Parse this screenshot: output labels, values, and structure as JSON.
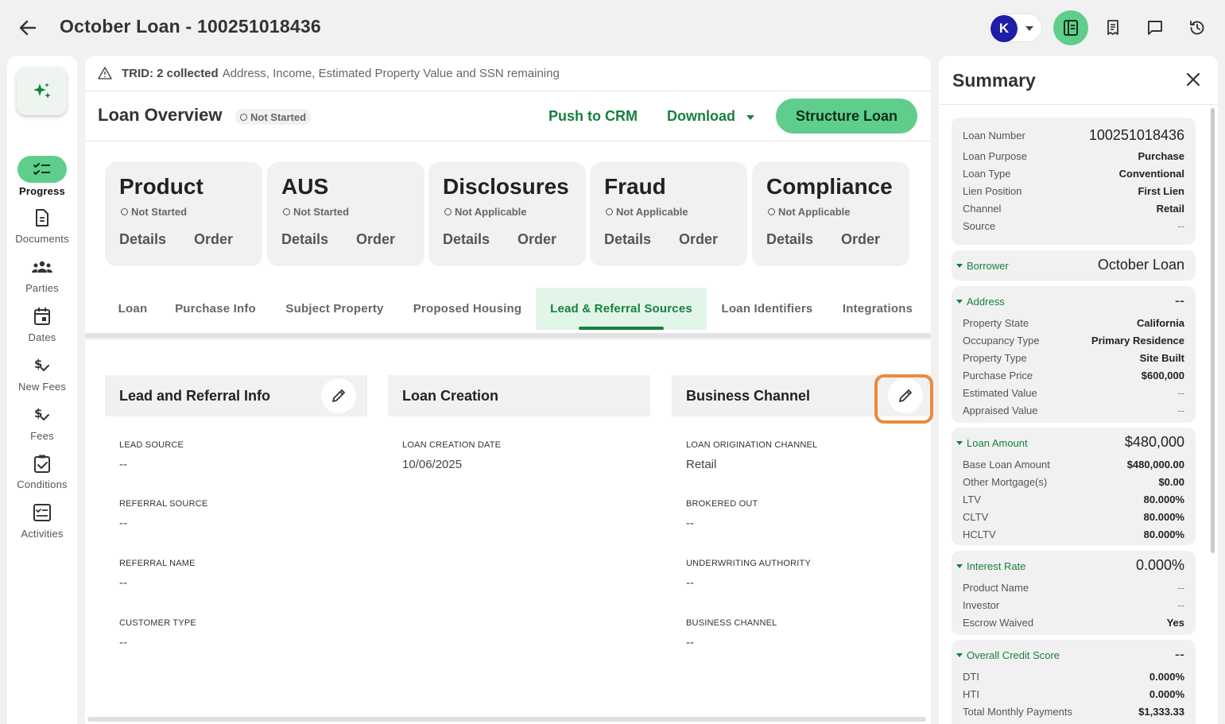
{
  "header": {
    "title": "October Loan - 100251018436",
    "avatar_initial": "K"
  },
  "nav": {
    "items": [
      {
        "label": "Progress"
      },
      {
        "label": "Documents"
      },
      {
        "label": "Parties"
      },
      {
        "label": "Dates"
      },
      {
        "label": "New Fees"
      },
      {
        "label": "Fees"
      },
      {
        "label": "Conditions"
      },
      {
        "label": "Activities"
      }
    ]
  },
  "trid": {
    "prefix": "TRID: 2 collected",
    "remaining": "Address, Income, Estimated Property Value and SSN remaining"
  },
  "overview": {
    "title": "Loan Overview",
    "status": "Not Started",
    "push_label": "Push to CRM",
    "download_label": "Download",
    "structure_label": "Structure Loan"
  },
  "cards": [
    {
      "title": "Product",
      "status": "Not Started",
      "details": "Details",
      "order": "Order"
    },
    {
      "title": "AUS",
      "status": "Not Started",
      "details": "Details",
      "order": "Order"
    },
    {
      "title": "Disclosures",
      "status": "Not Applicable",
      "details": "Details",
      "order": "Order"
    },
    {
      "title": "Fraud",
      "status": "Not Applicable",
      "details": "Details",
      "order": "Order"
    },
    {
      "title": "Compliance",
      "status": "Not Applicable",
      "details": "Details",
      "order": "Order"
    }
  ],
  "tabs": [
    "Loan",
    "Purchase Info",
    "Subject Property",
    "Proposed Housing",
    "Lead & Referral Sources",
    "Loan Identifiers",
    "Integrations"
  ],
  "sections": {
    "lead": {
      "title": "Lead and Referral Info",
      "fields": [
        {
          "label": "LEAD SOURCE",
          "value": "--"
        },
        {
          "label": "REFERRAL SOURCE",
          "value": "--"
        },
        {
          "label": "REFERRAL NAME",
          "value": "--"
        },
        {
          "label": "CUSTOMER TYPE",
          "value": "--"
        }
      ]
    },
    "creation": {
      "title": "Loan Creation",
      "fields": [
        {
          "label": "LOAN CREATION DATE",
          "value": "10/06/2025"
        }
      ]
    },
    "channel": {
      "title": "Business Channel",
      "fields": [
        {
          "label": "LOAN ORIGINATION CHANNEL",
          "value": "Retail"
        },
        {
          "label": "BROKERED OUT",
          "value": "--"
        },
        {
          "label": "UNDERWRITING AUTHORITY",
          "value": "--"
        },
        {
          "label": "BUSINESS CHANNEL",
          "value": "--"
        }
      ]
    }
  },
  "summary": {
    "title": "Summary",
    "loan": [
      {
        "k": "Loan Number",
        "v": "100251018436"
      },
      {
        "k": "Loan Purpose",
        "v": "Purchase"
      },
      {
        "k": "Loan Type",
        "v": "Conventional"
      },
      {
        "k": "Lien Position",
        "v": "First Lien"
      },
      {
        "k": "Channel",
        "v": "Retail"
      },
      {
        "k": "Source",
        "v": "--"
      }
    ],
    "borrower": {
      "k": "Borrower",
      "v": "October Loan"
    },
    "address": {
      "k": "Address",
      "v": "--",
      "rows": [
        {
          "k": "Property State",
          "v": "California"
        },
        {
          "k": "Occupancy Type",
          "v": "Primary Residence"
        },
        {
          "k": "Property Type",
          "v": "Site Built"
        },
        {
          "k": "Purchase Price",
          "v": "$600,000"
        },
        {
          "k": "Estimated Value",
          "v": "--"
        },
        {
          "k": "Appraised Value",
          "v": "--"
        }
      ]
    },
    "loan_amount": {
      "k": "Loan Amount",
      "v": "$480,000",
      "rows": [
        {
          "k": "Base Loan Amount",
          "v": "$480,000.00"
        },
        {
          "k": "Other Mortgage(s)",
          "v": "$0.00"
        },
        {
          "k": "LTV",
          "v": "80.000%"
        },
        {
          "k": "CLTV",
          "v": "80.000%"
        },
        {
          "k": "HCLTV",
          "v": "80.000%"
        }
      ]
    },
    "interest": {
      "k": "Interest Rate",
      "v": "0.000%",
      "rows": [
        {
          "k": "Product Name",
          "v": "--"
        },
        {
          "k": "Investor",
          "v": "--"
        },
        {
          "k": "Escrow Waived",
          "v": "Yes"
        }
      ]
    },
    "credit": {
      "k": "Overall Credit Score",
      "v": "--",
      "rows": [
        {
          "k": "DTI",
          "v": "0.000%"
        },
        {
          "k": "HTI",
          "v": "0.000%"
        },
        {
          "k": "Total Monthly Payments",
          "v": "$1,333.33"
        }
      ]
    }
  }
}
